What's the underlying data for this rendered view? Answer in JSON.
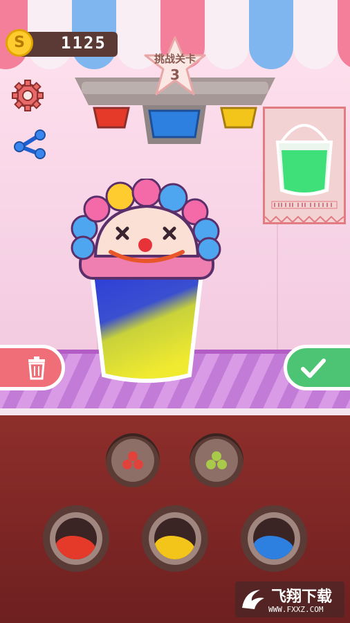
{
  "hud": {
    "coin_symbol": "S",
    "coins": "1125"
  },
  "level": {
    "label": "挑战关卡",
    "number": "3"
  },
  "colors": {
    "awning_pink": "#f47f9a",
    "awning_blue": "#7fb6ef",
    "awning_white": "#f8eef4",
    "syrup_red": "#e53a2a",
    "syrup_yellow": "#f3c51a",
    "syrup_blue": "#2d7fe0",
    "target_green": "#3fe07a",
    "check_green": "#4cc473",
    "trash_red": "#f06e78"
  },
  "icons": {
    "settings": "gear-icon",
    "share": "share-icon",
    "trash": "trash-icon",
    "confirm": "check-icon"
  },
  "toppings": [
    {
      "name": "red-balls",
      "color": "#e2423c"
    },
    {
      "name": "green-balls",
      "color": "#a8c94a"
    }
  ],
  "liquids": [
    {
      "name": "red",
      "color": "#e53a2a"
    },
    {
      "name": "yellow",
      "color": "#f3c51a"
    },
    {
      "name": "blue",
      "color": "#2d7fe0"
    }
  ],
  "watermark": {
    "title": "飞翔下载",
    "url": "WWW.FXXZ.COM"
  }
}
